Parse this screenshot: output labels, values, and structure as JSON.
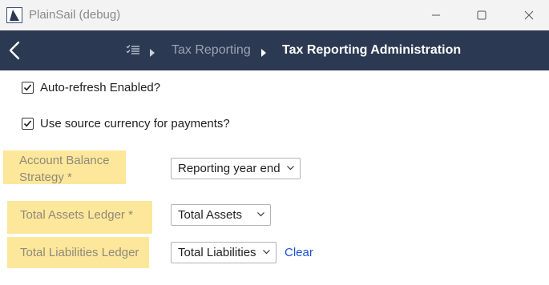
{
  "window": {
    "title": "PlainSail (debug)"
  },
  "nav": {
    "breadcrumbs": [
      "Tax Reporting",
      "Tax Reporting Administration"
    ]
  },
  "settings": {
    "auto_refresh": {
      "label": "Auto-refresh Enabled?",
      "checked": true
    },
    "source_currency": {
      "label": "Use source currency for payments?",
      "checked": true
    }
  },
  "fields": {
    "account_balance_strategy": {
      "label_line1": "Account Balance",
      "label_line2": "Strategy *",
      "value": "Reporting year end"
    },
    "total_assets_ledger": {
      "label": "Total Assets Ledger *",
      "value": "Total Assets"
    },
    "total_liabilities_ledger": {
      "label": "Total Liabilities Ledger",
      "value": "Total Liabilities",
      "clear_label": "Clear"
    }
  },
  "colors": {
    "navbar": "#2b3a52",
    "highlight": "#fde79a",
    "link": "#1a4fd6"
  }
}
